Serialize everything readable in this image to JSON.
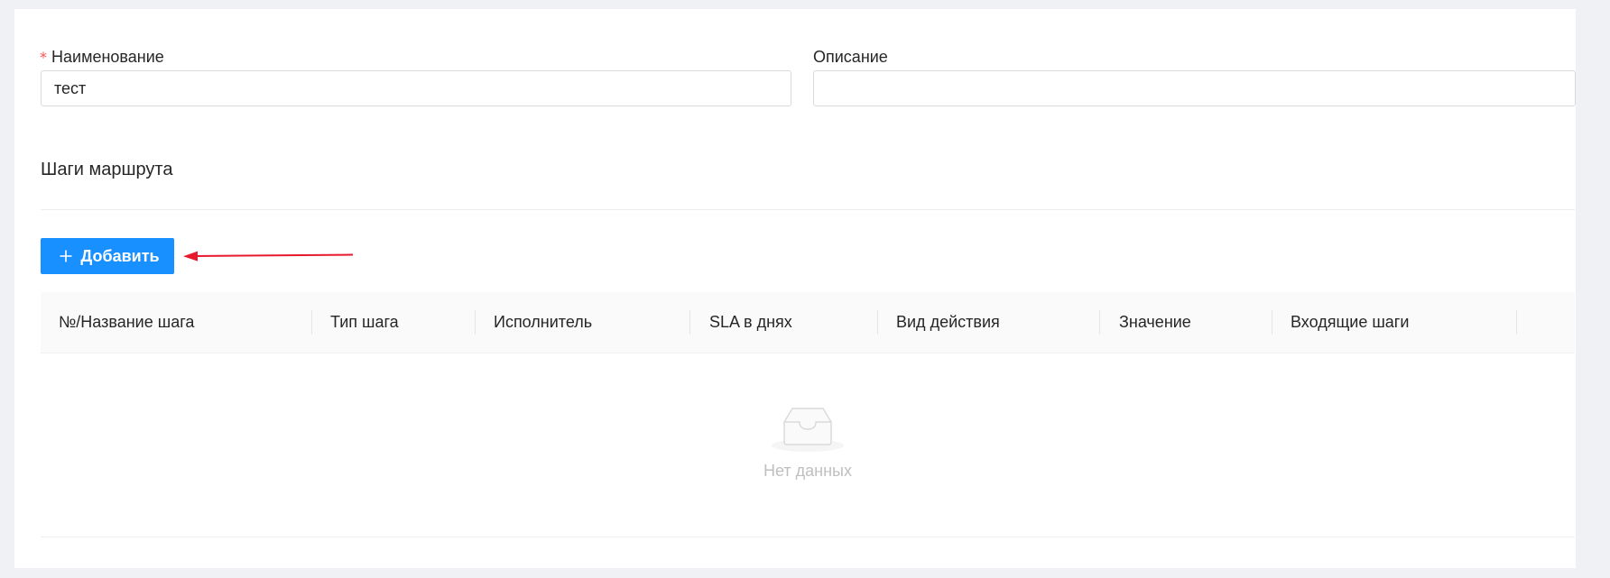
{
  "form": {
    "name": {
      "required_mark": "*",
      "label": "Наименование",
      "value": "тест"
    },
    "description": {
      "label": "Описание",
      "value": ""
    }
  },
  "steps": {
    "title": "Шаги маршрута",
    "add_button": {
      "icon": "plus-icon",
      "label": "Добавить"
    },
    "annotation": {
      "icon": "arrow-left-icon",
      "color": "#e8192c"
    },
    "table": {
      "columns": [
        "№/Название шага",
        "Тип шага",
        "Исполнитель",
        "SLA в днях",
        "Вид действия",
        "Значение",
        "Входящие шаги"
      ],
      "empty": {
        "icon": "empty-inbox-icon",
        "text": "Нет данных"
      }
    }
  },
  "colors": {
    "primary": "#1890ff",
    "required": "#ff4d4f",
    "page_background": "#eff1f4"
  }
}
